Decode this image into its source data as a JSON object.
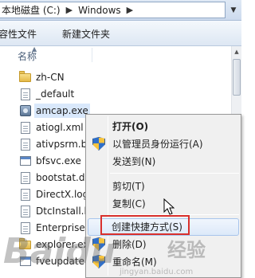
{
  "address_bar": {
    "crumbs": [
      "本地磁盘 (C:)",
      "Windows"
    ],
    "separator": "▶",
    "dropdown_icon": "chevron-down-icon"
  },
  "toolbar": {
    "include_label": "容性文件",
    "new_folder_label": "新建文件夹"
  },
  "columns": {
    "name_header": "名称"
  },
  "files": [
    {
      "name": "zh-CN",
      "icon": "folder-icon"
    },
    {
      "name": "_default",
      "icon": "document-icon"
    },
    {
      "name": "amcap.exe",
      "icon": "application-icon",
      "selected": true
    },
    {
      "name": "atiogl.xml",
      "icon": "document-icon"
    },
    {
      "name": "ativpsrm.bin",
      "icon": "document-icon"
    },
    {
      "name": "bfsvc.exe",
      "icon": "executable-icon"
    },
    {
      "name": "bootstat.dat",
      "icon": "document-icon"
    },
    {
      "name": "DirectX.log",
      "icon": "document-icon"
    },
    {
      "name": "DtcInstall.log",
      "icon": "document-icon"
    },
    {
      "name": "Enterprise.xml",
      "icon": "document-icon"
    },
    {
      "name": "explorer.exe",
      "icon": "folder-icon"
    },
    {
      "name": "fveupdate.exe",
      "icon": "executable-icon"
    }
  ],
  "context_menu": {
    "open": "打开(O)",
    "run_as_admin": "以管理员身份运行(A)",
    "send_to": "发送到(N)",
    "cut": "剪切(T)",
    "copy": "复制(C)",
    "create_shortcut": "创建快捷方式(S)",
    "delete": "删除(D)",
    "rename": "重命名(M)"
  },
  "watermark": {
    "logo": "Baidu",
    "sub": "经验",
    "site": "jingyan.baidu.com"
  },
  "colors": {
    "highlight_box": "#d9302c",
    "selection": "#d9e8fb",
    "menu_background": "#f0f0f0"
  }
}
